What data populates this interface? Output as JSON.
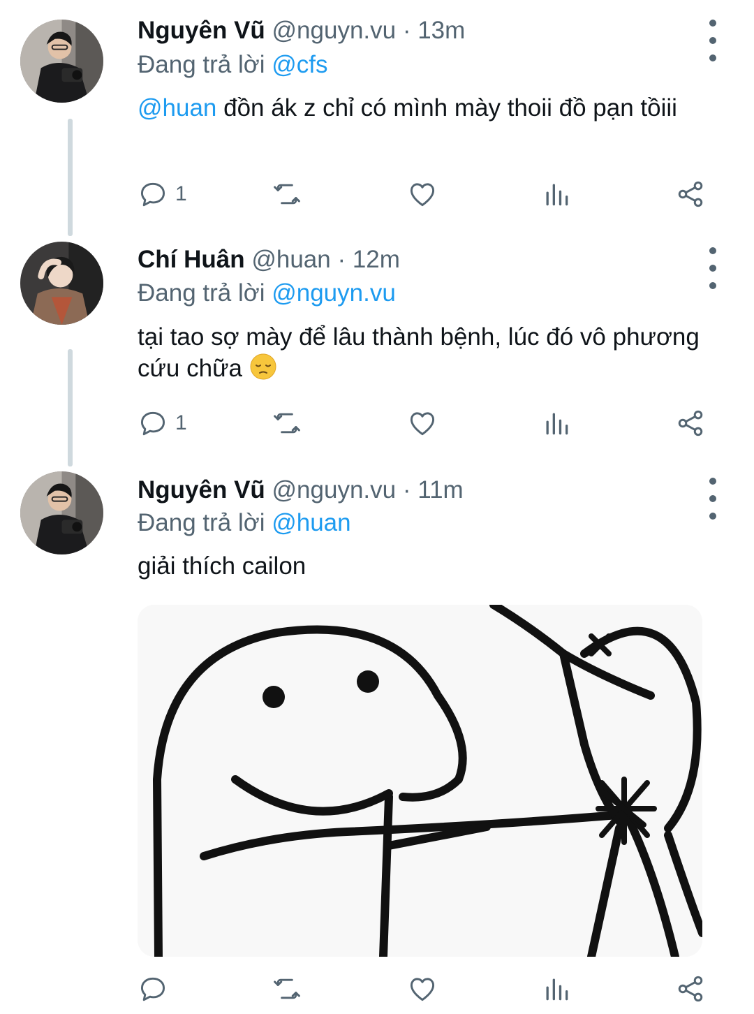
{
  "tweets": [
    {
      "name": "Nguyên Vũ",
      "handle_time": " @nguyn.vu · 13m",
      "reply_prefix": "Đang trả lời ",
      "reply_to": "@cfs",
      "mention": "@huan",
      "text": " đồn ák z chỉ có mình mày thoii đồ pạn tồiii",
      "reply_count": "1"
    },
    {
      "name": "Chí Huân",
      "handle_time": " @huan · 12m",
      "reply_prefix": "Đang trả lời ",
      "reply_to": "@nguyn.vu",
      "text": "tại tao sợ mày để lâu thành bệnh, lúc đó vô phương cứu chữa ",
      "emoji": "pensive-face",
      "reply_count": "1"
    },
    {
      "name": "Nguyên Vũ",
      "handle_time": " @nguyn.vu · 11m",
      "reply_prefix": "Đang trả lời ",
      "reply_to": "@huan",
      "text": "giải thích cailon",
      "reply_count": ""
    }
  ],
  "icons": {
    "reply": "reply-icon",
    "retweet": "retweet-icon",
    "like": "heart-icon",
    "views": "analytics-icon",
    "share": "share-icon",
    "more": "more-vertical-icon"
  },
  "colors": {
    "link": "#1d9bf0",
    "secondary_text": "#536471",
    "thread_line": "#cfd9de"
  }
}
